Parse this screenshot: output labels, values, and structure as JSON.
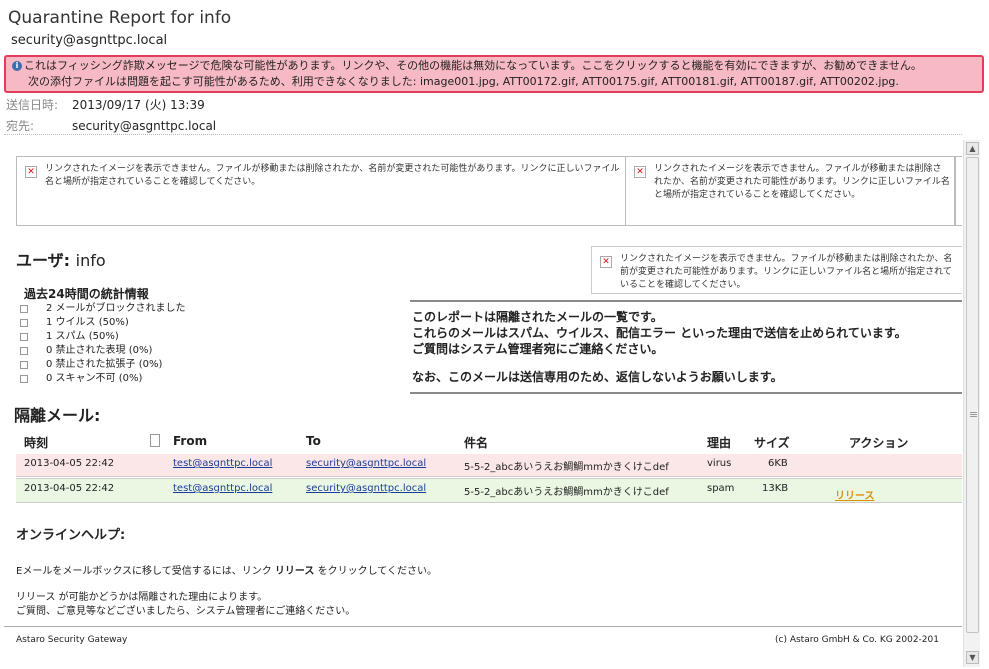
{
  "email": {
    "subject": "Quarantine Report for info",
    "sender": "security@asgnttpc.local",
    "warning_line1": "これはフィッシング詐欺メッセージで危険な可能性があります。リンクや、その他の機能は無効になっています。ここをクリックすると機能を有効にできますが、お勧めできません。",
    "warning_line2": "次の添付ファイルは問題を起こす可能性があるため、利用できなくなりました: image001.jpg, ATT00172.gif, ATT00175.gif, ATT00181.gif, ATT00187.gif, ATT00202.jpg.",
    "sent_label": "送信日時:",
    "sent_value": "2013/09/17 (火) 13:39",
    "to_label": "宛先:",
    "to_value": "security@asgnttpc.local"
  },
  "broken_image": {
    "text_a": "リンクされたイメージを表示できません。ファイルが移動または削除されたか、名前が変更された可能性があります。リンクに正しいファイル名と場所が指定されていることを確認してください。",
    "text_b": "リンクされたイメージを表示できません。ファイルが移動または削除されたか、名前が変更された可能性があります。リンクに正しいファイル名と場所が指定されていることを確認してください。",
    "text_c": "リンクされたイメージを表示できません。ファイルが移動または削除されたか、名前が変更された可能性があります。リンクに正しいファイル名と場所が指定されていることを確認してください。",
    "x_glyph": "✕"
  },
  "report": {
    "user_label": "ユーザ:",
    "user_name": "info",
    "stats_title": "過去24時間の統計情報",
    "stats": [
      "2 メールがブロックされました",
      "1 ウイルス (50%)",
      "1 スパム (50%)",
      "0 禁止された表現 (0%)",
      "0 禁止された拡張子 (0%)",
      "0 スキャン不可 (0%)"
    ],
    "notice": [
      "このレポートは隔離されたメールの一覧です。",
      "これらのメールはスパム、ウイルス、配信エラー といった理由で送信を止められています。",
      "ご質問はシステム管理者宛にご連絡ください。",
      "なお、このメールは送信専用のため、返信しないようお願いします。"
    ],
    "quarantine_title": "隔離メール:",
    "columns": {
      "time": "時刻",
      "from": "From",
      "to": "To",
      "subject": "件名",
      "reason": "理由",
      "size": "サイズ",
      "action": "アクション"
    },
    "rows": [
      {
        "time": "2013-04-05 22:42",
        "from": "test@asgnttpc.local",
        "to": "security@asgnttpc.local",
        "subject": "5-5-2_abcあいうえお鯛鯛mmかきくけこdef",
        "reason": "virus",
        "size": "6KB",
        "action": ""
      },
      {
        "time": "2013-04-05 22:42",
        "from": "test@asgnttpc.local",
        "to": "security@asgnttpc.local",
        "subject": "5-5-2_abcあいうえお鯛鯛mmかきくけこdef",
        "reason": "spam",
        "size": "13KB",
        "action": "リリース"
      }
    ],
    "help_title": "オンラインヘルプ:",
    "help_line1_a": "Eメールをメールボックスに移して受信するには、リンク ",
    "help_line1_b": "リリース",
    "help_line1_c": " をクリックしてください。",
    "help_line2": "リリース が可能かどうかは隔離された理由によります。",
    "help_line3": "ご質問、ご意見等などございましたら、システム管理者にご連絡ください。",
    "footer_left": "Astaro Security Gateway",
    "footer_right": "(c) Astaro GmbH & Co. KG 2002-201"
  },
  "icons": {
    "info": "info-icon",
    "scroll_up": "▲",
    "scroll_down": "▼"
  }
}
